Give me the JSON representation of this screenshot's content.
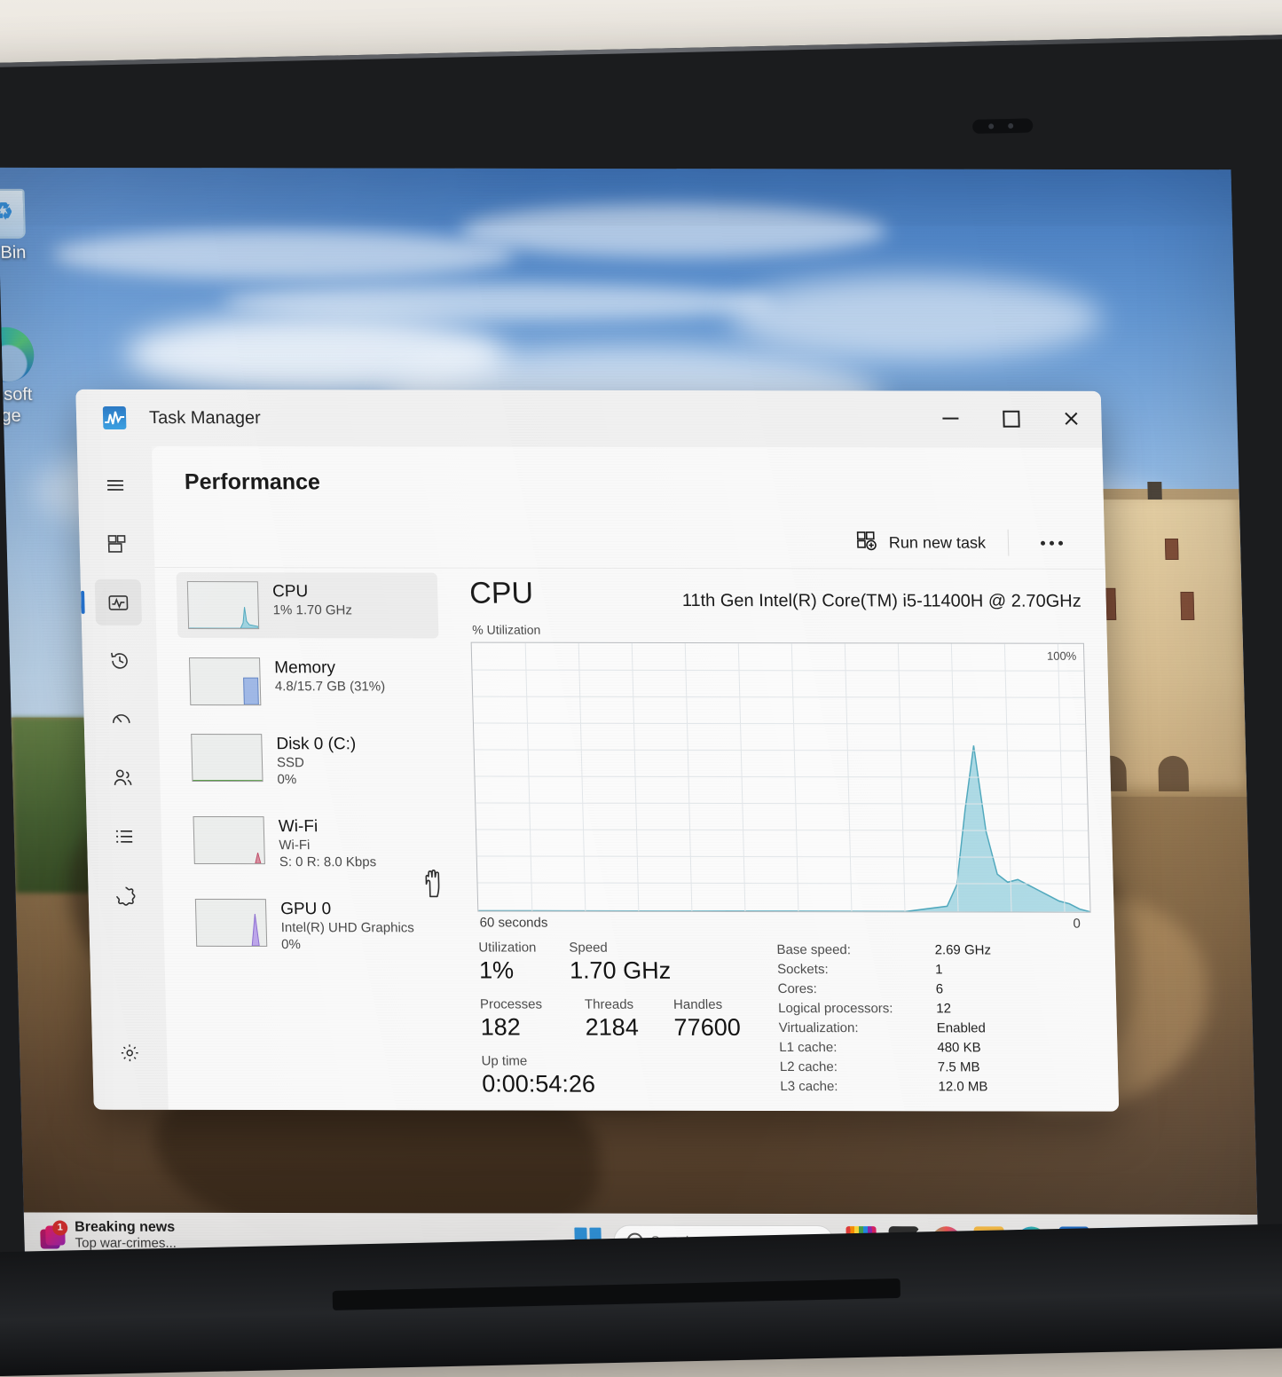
{
  "desktop": {
    "icons": [
      {
        "name": "Recycle Bin",
        "visible_label": "le Bin"
      },
      {
        "name": "Microsoft Edge",
        "visible_label_line1": "crosoft",
        "visible_label_line2": "dge"
      }
    ],
    "taskbar": {
      "news_widget": {
        "title": "Breaking news",
        "subtitle": "Top war-crimes...",
        "badge": "1"
      },
      "search_placeholder": "Search",
      "apps": [
        "start-icon",
        "search-box",
        "paint-icon",
        "file-explorer-icon",
        "copilot-icon",
        "folder-icon",
        "edge-icon",
        "store-icon",
        "task-manager-icon"
      ]
    }
  },
  "window": {
    "title": "Task Manager",
    "app_icon": "task-manager-icon",
    "controls": {
      "minimize": "–",
      "maximize": "□",
      "close": "✕"
    }
  },
  "rail": {
    "items": [
      {
        "name": "hamburger-menu-icon",
        "label": "Menu"
      },
      {
        "name": "processes-icon",
        "label": "Processes"
      },
      {
        "name": "performance-icon",
        "label": "Performance",
        "selected": true
      },
      {
        "name": "app-history-icon",
        "label": "App history"
      },
      {
        "name": "startup-apps-icon",
        "label": "Startup apps"
      },
      {
        "name": "users-icon",
        "label": "Users"
      },
      {
        "name": "details-icon",
        "label": "Details"
      },
      {
        "name": "services-icon",
        "label": "Services"
      }
    ],
    "settings": {
      "name": "settings-gear-icon",
      "label": "Settings"
    }
  },
  "page": {
    "title": "Performance",
    "toolbar": {
      "run_new_task": "Run new task",
      "run_new_task_icon": "new-task-plus-icon",
      "more_options": "more-options-icon"
    }
  },
  "resources": [
    {
      "name": "CPU",
      "sub1": "1% 1.70 GHz",
      "sub2": "",
      "selected": true,
      "color": "#4fa8bd"
    },
    {
      "name": "Memory",
      "sub1": "4.8/15.7 GB (31%)",
      "sub2": "",
      "selected": false,
      "color": "#7a9ed6"
    },
    {
      "name": "Disk 0 (C:)",
      "sub1": "SSD",
      "sub2": "0%",
      "selected": false,
      "color": "#5fa04e"
    },
    {
      "name": "Wi-Fi",
      "sub1": "Wi-Fi",
      "sub2": "S: 0 R: 8.0 Kbps",
      "selected": false,
      "color": "#c0506a"
    },
    {
      "name": "GPU 0",
      "sub1": "Intel(R) UHD Graphics",
      "sub2": "0%",
      "selected": false,
      "color": "#8d6fd1"
    }
  ],
  "detail": {
    "heading": "CPU",
    "model": "11th Gen Intel(R) Core(TM) i5-11400H @ 2.70GHz",
    "graph_axis_label": "% Utilization",
    "graph_max_label": "100%",
    "graph_time_label": "60 seconds",
    "graph_min_label": "0",
    "stats": [
      {
        "label": "Utilization",
        "value": "1%"
      },
      {
        "label": "Speed",
        "value": "1.70 GHz"
      },
      {
        "label": "Processes",
        "value": "182"
      },
      {
        "label": "Threads",
        "value": "2184"
      },
      {
        "label": "Handles",
        "value": "77600"
      },
      {
        "label": "Up time",
        "value": "0:00:54:26"
      }
    ],
    "system": [
      {
        "key": "Base speed:",
        "value": "2.69 GHz"
      },
      {
        "key": "Sockets:",
        "value": "1"
      },
      {
        "key": "Cores:",
        "value": "6"
      },
      {
        "key": "Logical processors:",
        "value": "12"
      },
      {
        "key": "Virtualization:",
        "value": "Enabled"
      },
      {
        "key": "L1 cache:",
        "value": "480 KB"
      },
      {
        "key": "L2 cache:",
        "value": "7.5 MB"
      },
      {
        "key": "L3 cache:",
        "value": "12.0 MB"
      }
    ]
  },
  "chart_data": {
    "type": "area",
    "title": "% Utilization",
    "xlabel": "60 seconds",
    "ylabel": "% Utilization",
    "ylim": [
      0,
      100
    ],
    "grid": true,
    "series": [
      {
        "name": "CPU utilization",
        "color": "#4fa8bd",
        "x": [
          0,
          5,
          10,
          15,
          20,
          25,
          30,
          35,
          40,
          42,
          44,
          46,
          47,
          48,
          49,
          50,
          51,
          52,
          53,
          54,
          55,
          56,
          57,
          58,
          59,
          60
        ],
        "values": [
          0,
          0,
          0,
          0,
          0,
          0,
          0,
          0,
          0,
          0,
          1,
          2,
          10,
          38,
          62,
          30,
          14,
          11,
          12,
          10,
          8,
          6,
          4,
          3,
          1,
          0
        ]
      }
    ]
  },
  "colors": {
    "accent": "#1668c9",
    "cpu_line": "#4fa8bd",
    "cpu_fill": "#9fd3e0",
    "window_bg": "#f3f3f3",
    "content_bg": "#f9f9f9"
  }
}
